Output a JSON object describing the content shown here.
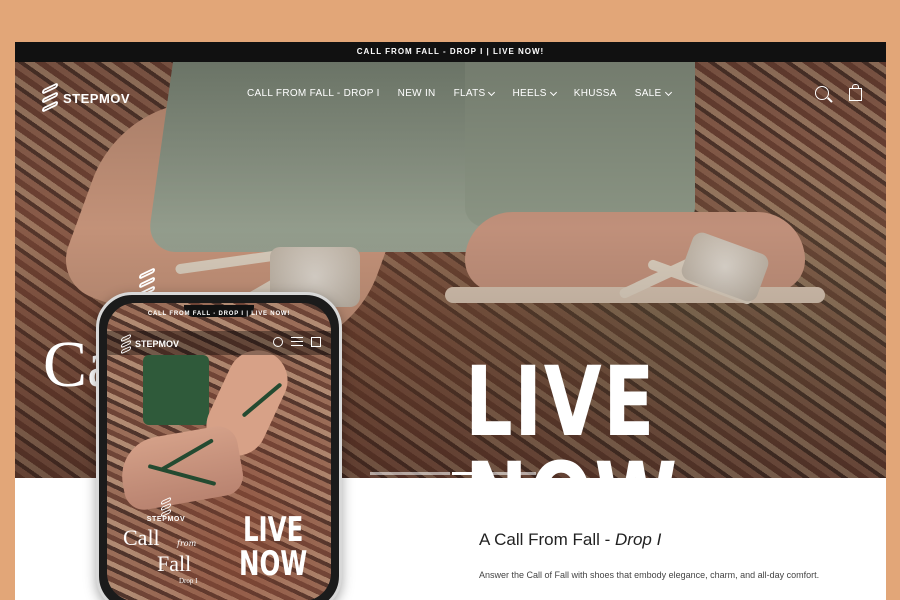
{
  "announcement": "CALL FROM FALL - DROP I | LIVE NOW!",
  "brand": "STEPMOV",
  "nav": {
    "items": [
      {
        "label": "CALL FROM FALL - DROP I",
        "has_dropdown": false
      },
      {
        "label": "NEW IN",
        "has_dropdown": false
      },
      {
        "label": "FLATS",
        "has_dropdown": true
      },
      {
        "label": "HEELS",
        "has_dropdown": true
      },
      {
        "label": "KHUSSA",
        "has_dropdown": false
      },
      {
        "label": "SALE",
        "has_dropdown": true
      }
    ],
    "icons": [
      "search-icon",
      "bag-icon"
    ]
  },
  "hero": {
    "headline": "LIVE NOW",
    "partial_text": "Ca",
    "slides": 3,
    "active_slide": 2
  },
  "content": {
    "title": "A Call From Fall - ",
    "title_italic": "Drop I",
    "description": "Answer the Call of Fall with shoes that embody elegance, charm, and all-day comfort."
  },
  "phone": {
    "announcement": "CALL FROM FALL - DROP I | LIVE NOW!",
    "brand": "STEPMOV",
    "brand_line": "STEPMOV",
    "call": "Call",
    "from": "from",
    "fall": "Fall",
    "drop": "Drop I",
    "live": "LIVE",
    "now": "NOW"
  },
  "colors": {
    "page_background": "#e2a678",
    "announcement_bar": "#111111",
    "text_primary": "#222222",
    "text_secondary": "#444444"
  }
}
